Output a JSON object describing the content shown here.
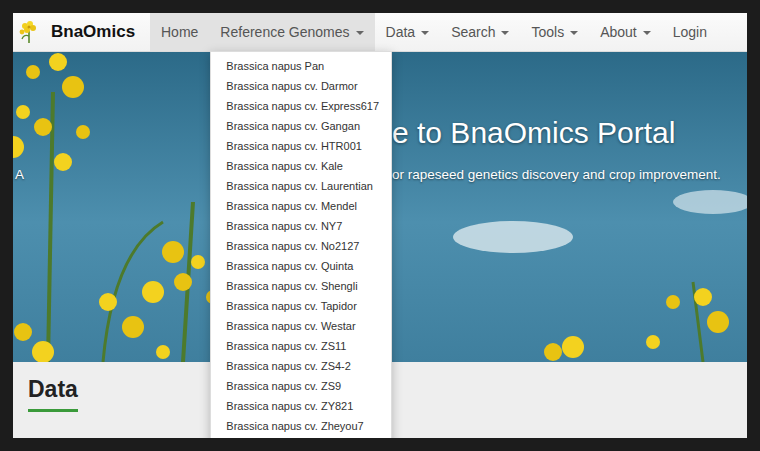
{
  "logo": {
    "text": "BnaOmics"
  },
  "nav": [
    {
      "label": "Home",
      "kind": "link",
      "selected": true,
      "expanded": false
    },
    {
      "label": "Reference Genomes",
      "kind": "dropdown",
      "selected": false,
      "expanded": true
    },
    {
      "label": "Data",
      "kind": "dropdown",
      "selected": false,
      "expanded": false
    },
    {
      "label": "Search",
      "kind": "dropdown",
      "selected": false,
      "expanded": false
    },
    {
      "label": "Tools",
      "kind": "dropdown",
      "selected": false,
      "expanded": false
    },
    {
      "label": "About",
      "kind": "dropdown",
      "selected": false,
      "expanded": false
    },
    {
      "label": "Login",
      "kind": "link",
      "selected": false,
      "expanded": false
    }
  ],
  "dropdown": {
    "items": [
      "Brassica napus Pan",
      "Brassica napus cv. Darmor",
      "Brassica napus cv. Express617",
      "Brassica napus cv. Gangan",
      "Brassica napus cv. HTR001",
      "Brassica napus cv. Kale",
      "Brassica napus cv. Laurentian",
      "Brassica napus cv. Mendel",
      "Brassica napus cv. NY7",
      "Brassica napus cv. No2127",
      "Brassica napus cv. Quinta",
      "Brassica napus cv. Shengli",
      "Brassica napus cv. Tapidor",
      "Brassica napus cv. Westar",
      "Brassica napus cv. ZS11",
      "Brassica napus cv. ZS4-2",
      "Brassica napus cv. ZS9",
      "Brassica napus cv. ZY821",
      "Brassica napus cv. Zheyou7"
    ]
  },
  "hero": {
    "title": "e to BnaOmics Portal",
    "subtitle_left": "A",
    "subtitle": "or rapeseed genetics discovery and crop improvement."
  },
  "section": {
    "heading": "Data"
  }
}
